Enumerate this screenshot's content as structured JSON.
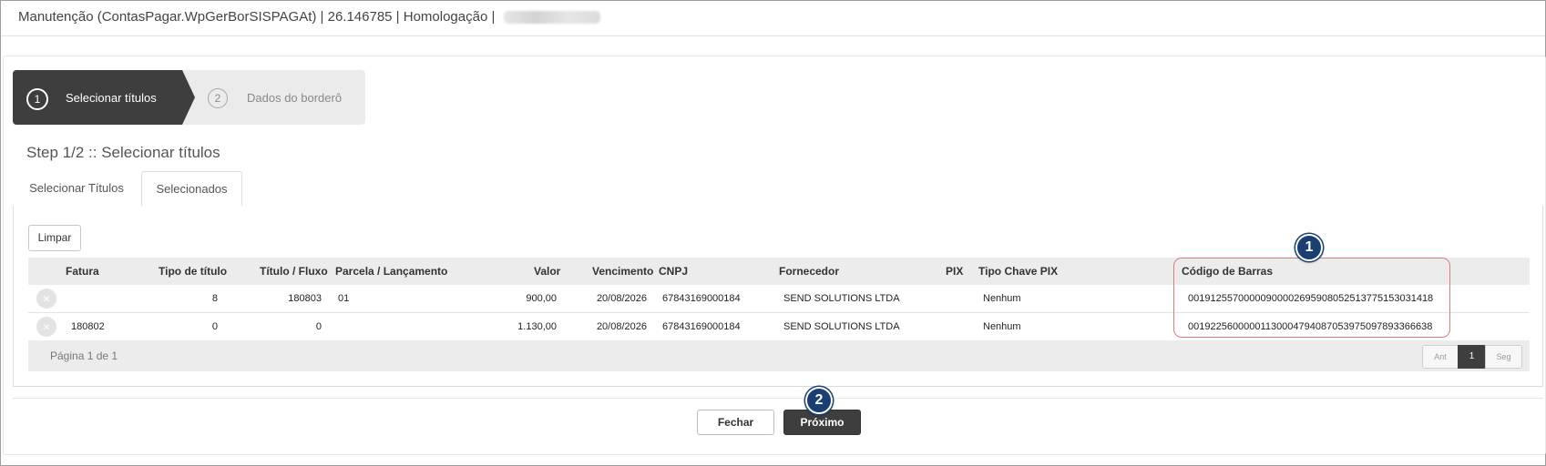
{
  "window": {
    "title": "Manutenção (ContasPagar.WpGerBorSISPAGAt) | 26.146785 | Homologação |"
  },
  "wizard": {
    "steps": [
      {
        "number": "1",
        "label": "Selecionar títulos",
        "state": "active"
      },
      {
        "number": "2",
        "label": "Dados do borderô",
        "state": "inactive"
      }
    ],
    "heading": "Step 1/2 :: Selecionar títulos"
  },
  "tabs": [
    {
      "label": "Selecionar Títulos",
      "selected": false
    },
    {
      "label": "Selecionados",
      "selected": true
    }
  ],
  "toolbar": {
    "limpar_label": "Limpar"
  },
  "grid": {
    "columns": [
      "Fatura",
      "Tipo de título",
      "Título / Fluxo",
      "Parcela / Lançamento",
      "Valor",
      "Vencimento",
      "CNPJ",
      "Fornecedor",
      "PIX",
      "Tipo Chave PIX",
      "Código de Barras"
    ],
    "rows": [
      {
        "remove_icon": "×",
        "fatura": "",
        "tipo_titulo": "8",
        "titulo_fluxo": "180803",
        "parcela": "01",
        "valor": "900,00",
        "vencimento": "20/08/2026",
        "cnpj": "67843169000184",
        "fornecedor": "SEND SOLUTIONS LTDA",
        "pix": "",
        "tipo_chave_pix": "Nenhum",
        "codigo_barras": "00191255700000900002695908052513775153031418"
      },
      {
        "remove_icon": "×",
        "fatura": "180802",
        "tipo_titulo": "0",
        "titulo_fluxo": "0",
        "parcela": "",
        "valor": "1.130,00",
        "vencimento": "20/08/2026",
        "cnpj": "67843169000184",
        "fornecedor": "SEND SOLUTIONS LTDA",
        "pix": "",
        "tipo_chave_pix": "Nenhum",
        "codigo_barras": "00192256000001130004794087053975097893366638"
      }
    ],
    "footer": {
      "page_info": "Página 1 de 1",
      "prev_label": "Ant",
      "current_page": "1",
      "next_label": "Seg"
    }
  },
  "annotations": {
    "badge1": "1",
    "badge2": "2",
    "highlight_color": "#e07b7b",
    "badge_color": "#1b3f73"
  },
  "actions": {
    "fechar_label": "Fechar",
    "proximo_label": "Próximo"
  },
  "colors": {
    "active_step": "#3e3e3e",
    "inactive_step": "#ebebeb",
    "header_bg": "#ececec"
  }
}
